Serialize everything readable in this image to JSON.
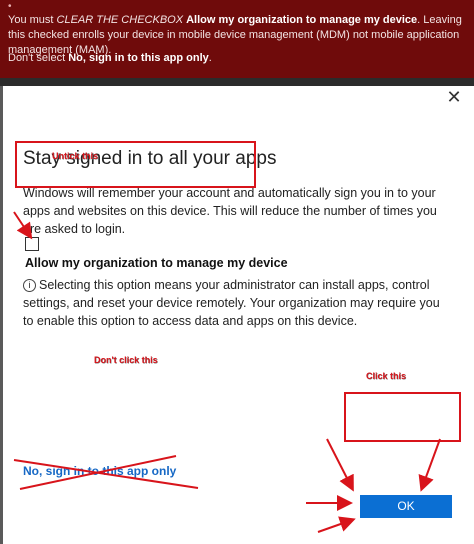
{
  "banner": {
    "dot": "•",
    "line1_prefix": "You must ",
    "line1_italic": "CLEAR THE CHECKBOX",
    "line1_bold": "Allow my organization to manage my device",
    "line1_suffix": ". Leaving this checked enrolls your device in mobile device management (MDM) not mobile application management (MAM).",
    "line2_prefix": "Don't select ",
    "line2_bold": "No, sign in to this app only",
    "line2_suffix": "."
  },
  "dialog": {
    "close_glyph": "✕",
    "title": "Stay signed in to all your apps",
    "description": "Windows will remember your account and automatically sign you in to your apps and websites on this device. This will reduce the number of times you are asked to login.",
    "checkbox_label": "Allow my organization to manage my device",
    "info_icon_glyph": "i",
    "info_text": "Selecting this option means your administrator can install apps, control settings, and reset your device remotely. Your organization may require you to enable this option to access data and apps on this device.",
    "no_link": "No, sign in to this app only",
    "ok_label": "OK"
  },
  "annotations": {
    "untick": "Untick this",
    "dont_click": "Don't click this",
    "click_this": "Click this",
    "color": "#d8141b"
  },
  "colors": {
    "banner_bg": "#6f0b0b",
    "link": "#1668c5",
    "ok_bg": "#0b6fd3"
  }
}
